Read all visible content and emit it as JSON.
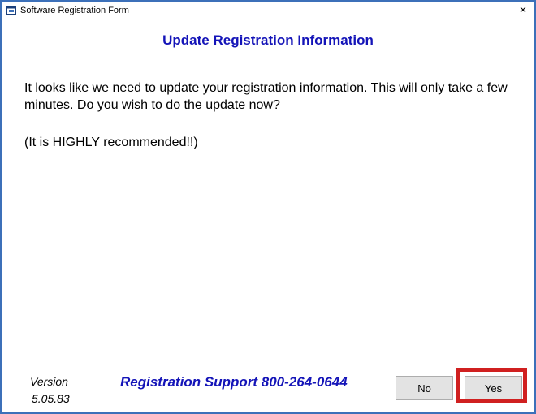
{
  "window": {
    "title": "Software Registration Form",
    "close_glyph": "×",
    "icon": "app-window-icon"
  },
  "dialog": {
    "heading": "Update Registration Information",
    "message": "It looks like we need to update your registration information. This will only take a few minutes. Do you wish to do the update now?",
    "recommendation": "(It is HIGHLY recommended!!)"
  },
  "footer": {
    "version_label": "Version",
    "version_number": "5.05.83",
    "support_text": "Registration Support 800-264-0644"
  },
  "buttons": {
    "no_label": "No",
    "yes_label": "Yes"
  },
  "colors": {
    "frame_border": "#3c70b9",
    "heading_blue": "#1414b8",
    "highlight_red": "#d02020"
  }
}
